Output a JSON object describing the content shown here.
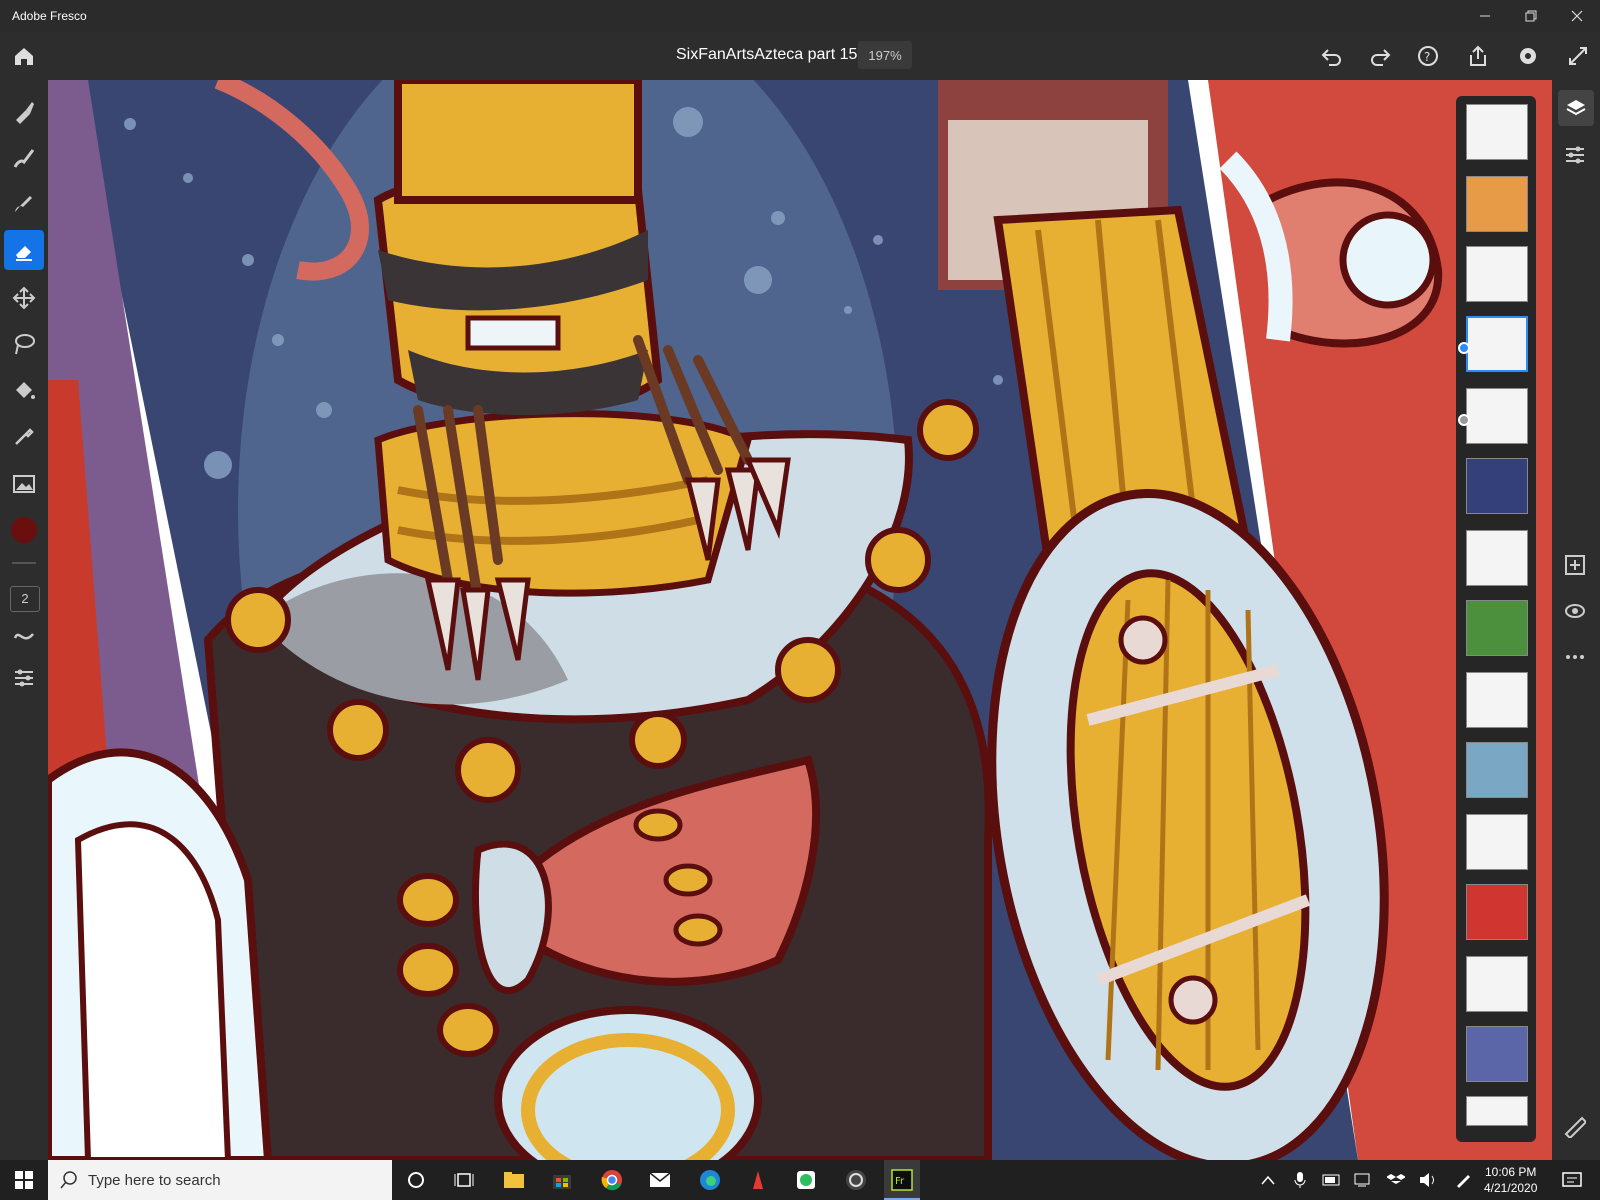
{
  "window": {
    "title": "Adobe Fresco"
  },
  "header": {
    "doc_title": "SixFanArtsAzteca part 15",
    "zoom": "197%"
  },
  "tools": {
    "brush_size": "2"
  },
  "taskbar": {
    "search_placeholder": "Type here to search",
    "time": "10:06 PM",
    "date": "4/21/2020"
  },
  "colors": {
    "accent": "#1473e6",
    "current_color": "#6b0e0e"
  }
}
